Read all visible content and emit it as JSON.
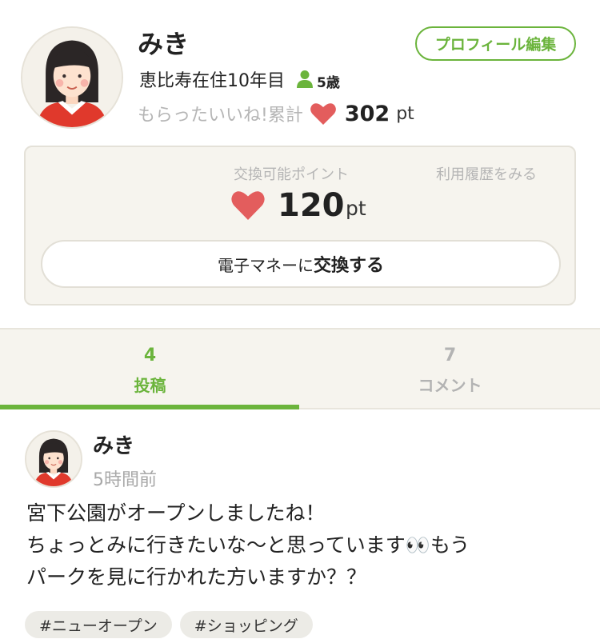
{
  "profile": {
    "name": "みき",
    "edit_label": "プロフィール編集",
    "residence": "恵比寿在住10年目",
    "age": "5歳",
    "likes_label": "もらったいいね!累計",
    "likes_value": "302",
    "likes_unit": "pt"
  },
  "points": {
    "label": "交換可能ポイント",
    "history_label": "利用履歴をみる",
    "value": "120",
    "unit": "pt",
    "exchange_prefix": "電子マネーに",
    "exchange_action": "交換する"
  },
  "tabs": [
    {
      "count": "4",
      "label": "投稿",
      "active": true
    },
    {
      "count": "7",
      "label": "コメント",
      "active": false
    }
  ],
  "post": {
    "author": "みき",
    "time": "5時間前",
    "lines": [
      "宮下公園がオープンしましたね！",
      "ちょっとみに行きたいな〜と思っています👀もう",
      "パークを見に行かれた方いますか？？"
    ],
    "tags": [
      "#ニューオープン",
      "#ショッピング"
    ]
  },
  "colors": {
    "accent": "#6bb43c",
    "heart": "#e35d5d",
    "muted": "#b5b5b5",
    "card_bg": "#f6f4ee"
  },
  "icons": [
    "avatar",
    "person-icon",
    "heart-icon"
  ]
}
